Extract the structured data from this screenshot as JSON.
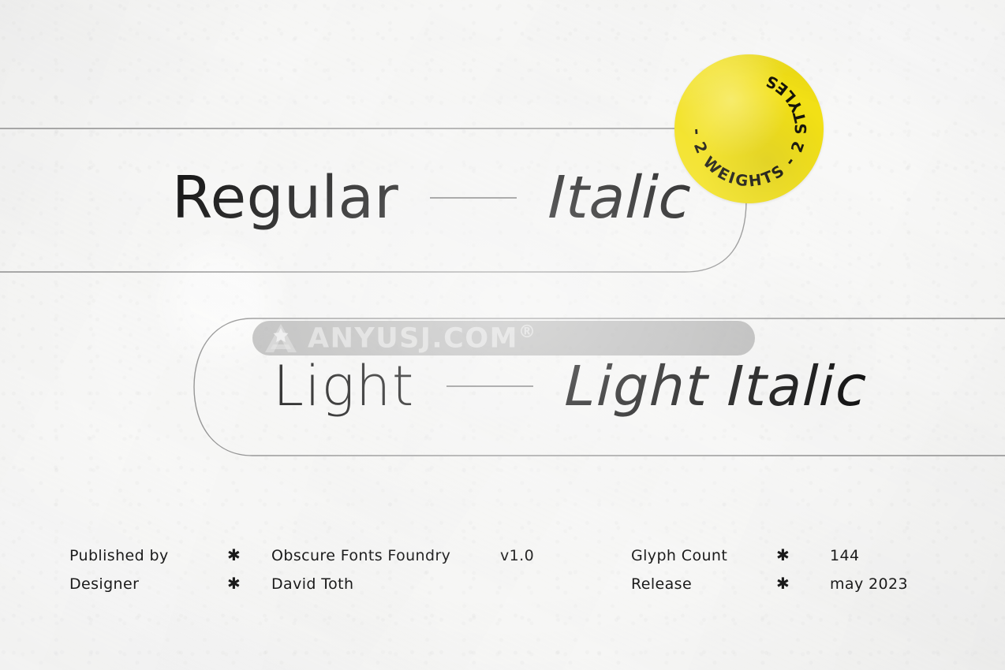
{
  "poster": {
    "background_color": "#f7f7f6",
    "ink_color": "#111111",
    "rule_color": "#8b8b8b"
  },
  "specimen": {
    "rows": [
      {
        "id": "regular",
        "left_style": "Regular",
        "separator": "dash",
        "right_style": "Italic"
      },
      {
        "id": "light",
        "left_style": "Light",
        "separator": "dash",
        "right_style": "Light Italic"
      }
    ]
  },
  "badge": {
    "color": "#f2e016",
    "text_color": "#16140a",
    "circular_text": "- 2 WEIGHTS - 2 STYLES ",
    "reads": "2 WEIGHTS - 2 STYLES -"
  },
  "watermark": {
    "text": "ANYUSJ.COM",
    "registered_mark": "®",
    "logo_name": "a-star-logo",
    "bar_color": "#7c7c7c"
  },
  "footer": {
    "rows": [
      {
        "label": "Published by",
        "star": "✱",
        "value": "Obscure Fonts Foundry",
        "version": "v1.0",
        "right_label": "Glyph Count",
        "right_star": "✱",
        "right_value": "144"
      },
      {
        "label": "Designer",
        "star": "✱",
        "value": "David Toth",
        "version": "",
        "right_label": "Release",
        "right_star": "✱",
        "right_value": "may 2023"
      }
    ]
  }
}
